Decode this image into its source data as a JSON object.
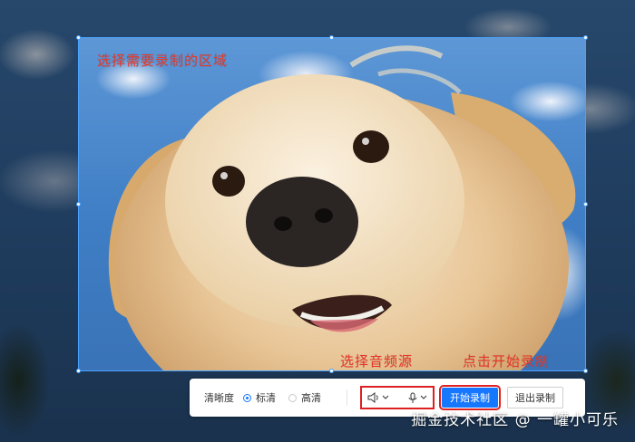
{
  "annotations": {
    "select_area": "选择需要录制的区域",
    "select_audio": "选择音频源",
    "click_start": "点击开始录制"
  },
  "toolbar": {
    "clarity_label": "清晰度",
    "options": [
      {
        "label": "标清",
        "selected": true
      },
      {
        "label": "高清",
        "selected": false
      }
    ],
    "speaker_icon": "speaker-icon",
    "mic_icon": "microphone-icon",
    "start_label": "开始录制",
    "exit_label": "退出录制"
  },
  "watermark": "掘金技术社区 @ 一罐小可乐",
  "colors": {
    "accent": "#1677ff",
    "highlight": "#e02020",
    "selection_border": "#4aa3ff"
  }
}
